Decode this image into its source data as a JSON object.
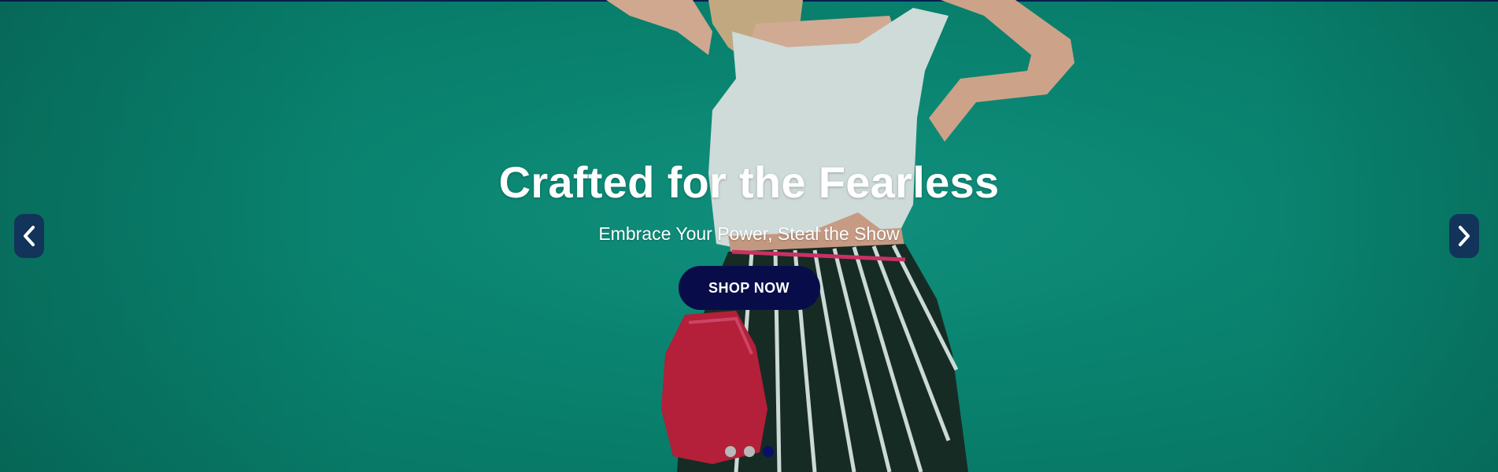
{
  "slide": {
    "heading": "Crafted for the Fearless",
    "subheading": "Embrace Your Power, Steal the Show",
    "cta_label": "SHOP NOW"
  },
  "carousel": {
    "prev_icon": "chevron-left-icon",
    "next_icon": "chevron-right-icon",
    "indicators": [
      {
        "active": false
      },
      {
        "active": false
      },
      {
        "active": true
      }
    ]
  },
  "colors": {
    "background": "#0a8d78",
    "cta_background": "#080d4a",
    "arrow_background": "#12345a",
    "indicator_inactive": "#b8b8b8",
    "indicator_active": "#0a0f6a"
  }
}
